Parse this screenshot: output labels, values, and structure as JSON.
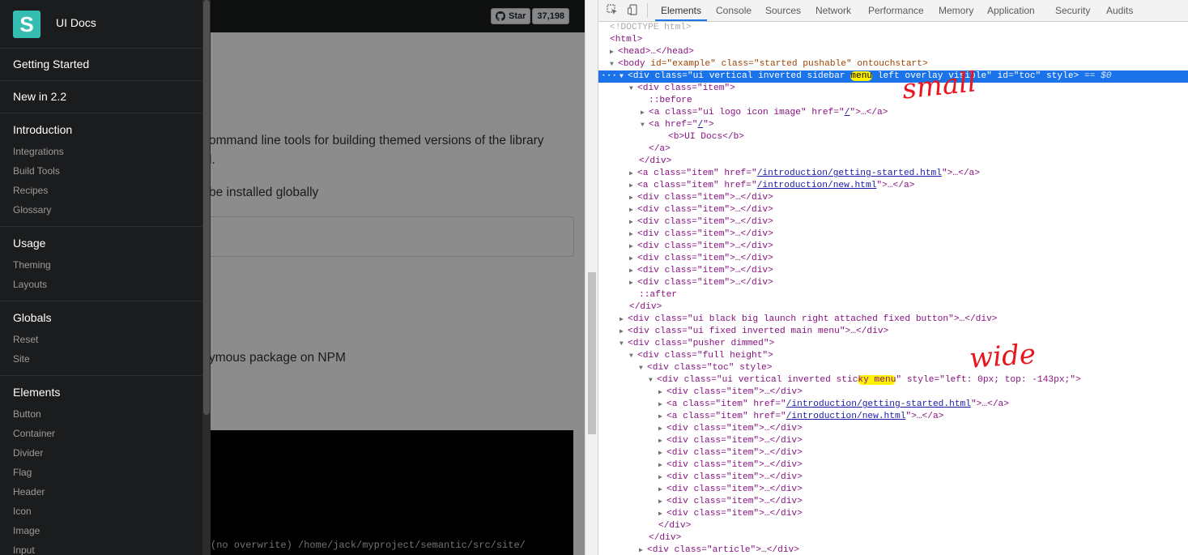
{
  "browser": {
    "github": {
      "star_label": "Star",
      "star_count": "37,198"
    },
    "content": {
      "line1": "ommand line tools for building themed versions of the library",
      "line2": "l.",
      "line3": "be installed globally",
      "line4": "ymous package on NPM",
      "terminal_text": "(no overwrite) /home/jack/myproject/semantic/src/site/"
    }
  },
  "sidebar": {
    "brand": "UI Docs",
    "logo_letter": "S",
    "top_items": [
      "Getting Started",
      "New in 2.2"
    ],
    "groups": [
      {
        "title": "Introduction",
        "items": [
          "Integrations",
          "Build Tools",
          "Recipes",
          "Glossary"
        ]
      },
      {
        "title": "Usage",
        "items": [
          "Theming",
          "Layouts"
        ]
      },
      {
        "title": "Globals",
        "items": [
          "Reset",
          "Site"
        ]
      },
      {
        "title": "Elements",
        "items": [
          "Button",
          "Container",
          "Divider",
          "Flag",
          "Header",
          "Icon",
          "Image",
          "Input"
        ]
      }
    ]
  },
  "devtools": {
    "tabs": [
      "Elements",
      "Console",
      "Sources",
      "Network",
      "Performance",
      "Memory",
      "Application",
      "Security",
      "Audits"
    ],
    "active_tab": "Elements",
    "annotations": {
      "small": "small",
      "wide": "wide"
    },
    "dom_text": {
      "doctype": "<!DOCTYPE html>",
      "html_open": "<html>",
      "head": "<head>…</head>",
      "body_open_tag": "<body",
      "body_attrs": " id=\"example\" class=\"started pushable\" ontouchstart>",
      "sel_prefix": "<div class=\"ui vertical inverted sidebar ",
      "sel_hl": "menu",
      "sel_suffix": " left overlay visible\" id=\"toc\" style>",
      "sel_eq": " == $0",
      "div_item_open": "<div class=\"item\">",
      "before": "::before",
      "logo_a_prefix": "<a class=\"ui logo icon image\" href=\"",
      "logo_href": "/",
      "logo_a_suffix": "\">…</a>",
      "a_open_prefix": "<a href=\"",
      "a_open_href": "/",
      "a_open_suffix": "\">",
      "b_text": "<b>UI Docs</b>",
      "a_close": "</a>",
      "div_close": "</div>",
      "item_a_prefix": "<a class=\"item\" href=\"",
      "href_getting_started": "/introduction/getting-started.html",
      "href_new": "/introduction/new.html",
      "item_a_suffix": "\">…</a>",
      "div_item_collapsed": "<div class=\"item\">…</div>",
      "after": "::after",
      "launch_btn": "<div class=\"ui black big launch right attached fixed button\">…</div>",
      "fixed_menu": "<div class=\"ui fixed inverted main menu\">…</div>",
      "pusher": "<div class=\"pusher dimmed\">",
      "full_height": "<div class=\"full height\">",
      "toc_style": "<div class=\"toc\" style>",
      "sticky_prefix": "<div class=\"ui vertical inverted stic",
      "sticky_hl": "ky menu",
      "sticky_suffix": "\" style=\"left: 0px; top: -143px;\">",
      "article": "<div class=\"article\">…</div>"
    }
  }
}
